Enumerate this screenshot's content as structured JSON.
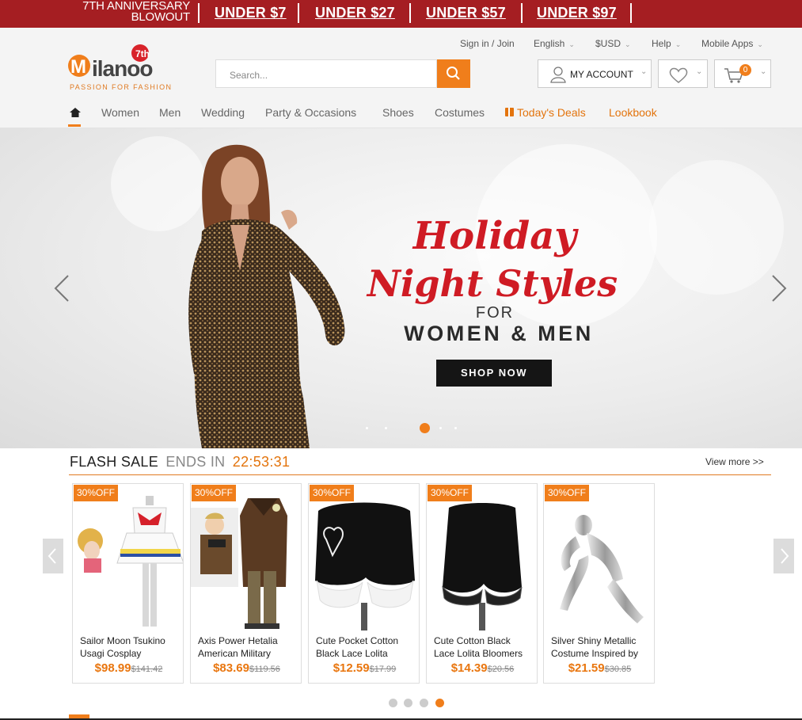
{
  "promo": {
    "anniversary_line1": "7TH ANNIVERSARY",
    "anniversary_line2": "BLOWOUT",
    "deals": [
      "UNDER $7",
      "UNDER $27",
      "UNDER $57",
      "UNDER $97"
    ],
    "background": "#a51e22"
  },
  "topbar": {
    "signin": "Sign in / Join",
    "language": "English",
    "currency": "$USD",
    "help": "Help",
    "mobile": "Mobile Apps"
  },
  "logo": {
    "wordmark": "Milanoo",
    "tagline": "PASSION FOR FASHION",
    "badge": "7th"
  },
  "search": {
    "placeholder": "Search..."
  },
  "account": {
    "label": "MY ACCOUNT"
  },
  "cart": {
    "count": "0"
  },
  "nav": {
    "items": [
      "Women",
      "Men",
      "Wedding",
      "Party & Occasions",
      "Shoes",
      "Costumes"
    ],
    "deals": "Today's Deals",
    "lookbook": "Lookbook"
  },
  "hero": {
    "line1": "Holiday",
    "line2": "Night Styles",
    "for": "FOR",
    "audience": "WOMEN & MEN",
    "cta": "SHOP NOW",
    "active_slide": 3,
    "slide_count": 5
  },
  "flash": {
    "title": "FLASH SALE",
    "ends_label": "ENDS IN",
    "countdown": "22:53:31",
    "view_more": "View more >>"
  },
  "products": [
    {
      "badge": "30%OFF",
      "name1": "Sailor Moon Tsukino",
      "name2": "Usagi Cosplay",
      "price": "$98.99",
      "was": "$141.42"
    },
    {
      "badge": "30%OFF",
      "name1": "Axis Power Hetalia",
      "name2": "American Military",
      "price": "$83.69",
      "was": "$119.56"
    },
    {
      "badge": "30%OFF",
      "name1": "Cute Pocket Cotton",
      "name2": "Black Lace Lolita",
      "price": "$12.59",
      "was": "$17.99"
    },
    {
      "badge": "30%OFF",
      "name1": "Cute Cotton Black",
      "name2": "Lace Lolita Bloomers",
      "price": "$14.39",
      "was": "$20.56"
    },
    {
      "badge": "30%OFF",
      "name1": "Silver Shiny Metallic",
      "name2": "Costume Inspired by",
      "price": "$21.59",
      "was": "$30.85"
    }
  ],
  "carousel": {
    "active_page": 4,
    "page_count": 4
  },
  "colors": {
    "accent": "#f07e1b",
    "promo": "#a51e22",
    "hero_red": "#cf1b24"
  }
}
